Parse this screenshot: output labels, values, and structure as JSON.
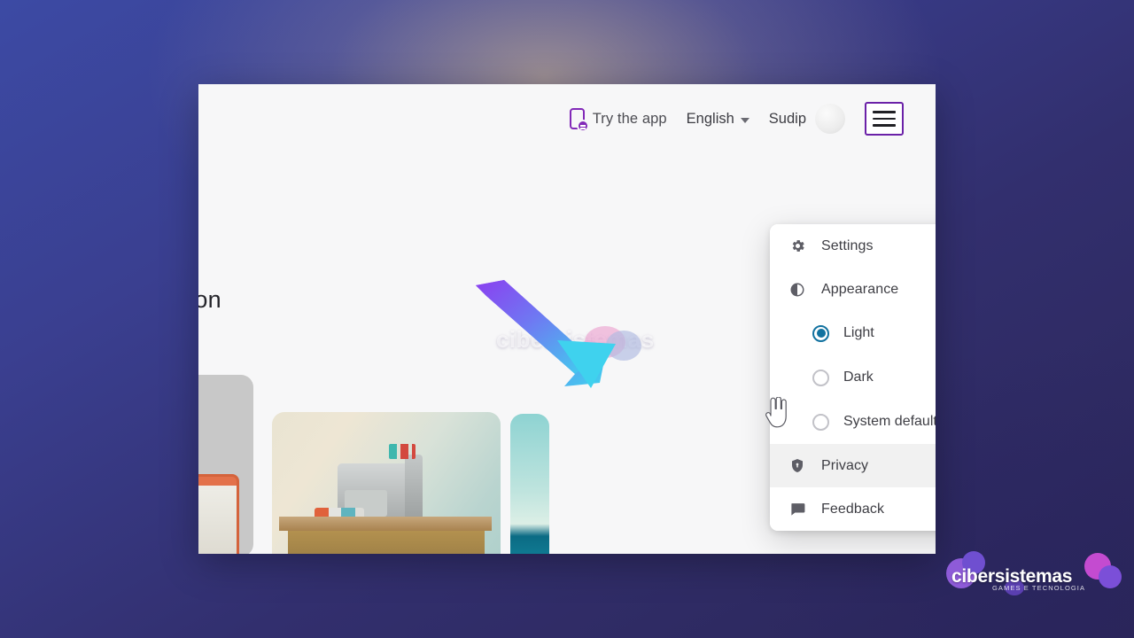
{
  "window": {
    "topbar": {
      "try_app_label": "Try the app",
      "language_label": "English",
      "user_name": "Sudip"
    },
    "page": {
      "hero_title_fragment": "nion"
    }
  },
  "menu": {
    "items": [
      {
        "label": "Settings",
        "icon": "gear-icon",
        "chevron": "chevron-down-icon",
        "state": "collapsed"
      },
      {
        "label": "Appearance",
        "icon": "contrast-icon",
        "chevron": "chevron-up-icon",
        "state": "expanded"
      },
      {
        "label": "Privacy",
        "icon": "shield-lock-icon",
        "state": "hovered"
      },
      {
        "label": "Feedback",
        "icon": "comment-icon",
        "state": "normal"
      }
    ],
    "appearance_options": [
      {
        "label": "Light",
        "selected": true,
        "preview": "light-theme-preview"
      },
      {
        "label": "Dark",
        "selected": false,
        "preview": "dark-theme-preview"
      },
      {
        "label": "System default",
        "selected": false,
        "preview": "system-theme-preview"
      }
    ]
  },
  "annotation": {
    "arrow": "gradient-arrow-pointing-down-right",
    "arrow_color_start": "#8b3ff0",
    "arrow_color_end": "#3fd2ee"
  },
  "watermark": {
    "overlay_text": "cibersistemas",
    "logo_text": "cibersistemas",
    "logo_subtitle": "GAMES E TECNOLOGIA"
  },
  "colors": {
    "accent_purple": "#6b21a8",
    "radio_selected": "#1272a0",
    "menu_bg": "#ffffff",
    "hover_bg": "#f1f1f1",
    "page_bg": "#f7f7f8",
    "desktop_gradient_from": "#3c4aa4",
    "desktop_gradient_to": "#2b2657"
  }
}
